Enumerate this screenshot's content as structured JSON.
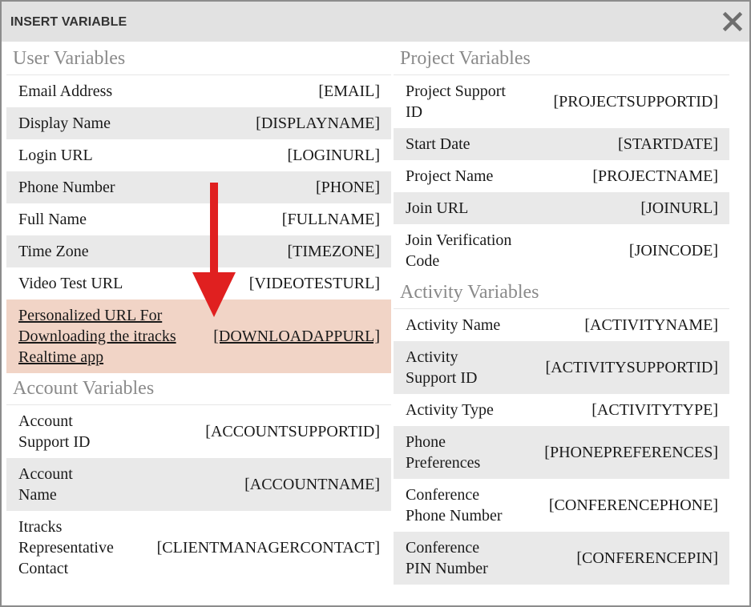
{
  "dialog": {
    "title": "INSERT VARIABLE",
    "close_glyph": "✕"
  },
  "user_variables": {
    "title": "User Variables",
    "rows": [
      {
        "label": "Email Address",
        "token": "[EMAIL]"
      },
      {
        "label": "Display Name",
        "token": "[DISPLAYNAME]"
      },
      {
        "label": "Login URL",
        "token": "[LOGINURL]"
      },
      {
        "label": "Phone Number",
        "token": "[PHONE]"
      },
      {
        "label": "Full Name",
        "token": "[FULLNAME]"
      },
      {
        "label": "Time Zone",
        "token": "[TIMEZONE]"
      },
      {
        "label": "Video Test URL",
        "token": "[VIDEOTESTURL]"
      },
      {
        "label": "Personalized URL For Downloading the itracks Realtime app",
        "token": "[DOWNLOADAPPURL]"
      }
    ]
  },
  "account_variables": {
    "title": "Account Variables",
    "rows": [
      {
        "label": "Account Support ID",
        "token": "[ACCOUNTSUPPORTID]"
      },
      {
        "label": "Account Name",
        "token": "[ACCOUNTNAME]"
      },
      {
        "label": "Itracks Representative Contact",
        "token": "[CLIENTMANAGERCONTACT]"
      }
    ]
  },
  "project_variables": {
    "title": "Project Variables",
    "rows": [
      {
        "label": "Project Support ID",
        "token": "[PROJECTSUPPORTID]"
      },
      {
        "label": "Start Date",
        "token": "[STARTDATE]"
      },
      {
        "label": "Project Name",
        "token": "[PROJECTNAME]"
      },
      {
        "label": "Join URL",
        "token": "[JOINURL]"
      },
      {
        "label": "Join Verification Code",
        "token": "[JOINCODE]"
      }
    ]
  },
  "activity_variables": {
    "title": "Activity Variables",
    "rows": [
      {
        "label": "Activity Name",
        "token": "[ACTIVITYNAME]"
      },
      {
        "label": "Activity Support ID",
        "token": "[ACTIVITYSUPPORTID]"
      },
      {
        "label": "Activity Type",
        "token": "[ACTIVITYTYPE]"
      },
      {
        "label": "Phone Preferences",
        "token": "[PHONEPREFERENCES]"
      },
      {
        "label": "Conference Phone Number",
        "token": "[CONFERENCEPHONE]"
      },
      {
        "label": "Conference PIN Number",
        "token": "[CONFERENCEPIN]"
      }
    ]
  },
  "colors": {
    "highlight_row": "#f1d4c6",
    "alt_row": "#e9e9e9",
    "arrow": "#e02020",
    "titlebar": "#e2e2e2"
  },
  "icons": {
    "close": "close-icon",
    "annotation": "arrow-down-icon"
  }
}
